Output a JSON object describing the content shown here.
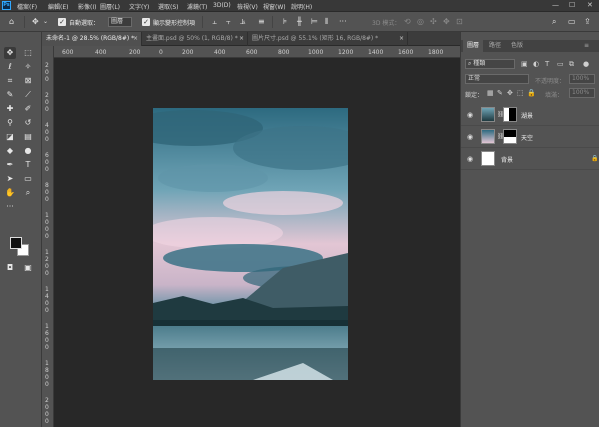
{
  "app": {
    "logo_text": "Ps"
  },
  "menu": [
    "檔案(F)",
    "編輯(E)",
    "影像(I)",
    "圖層(L)",
    "文字(Y)",
    "選取(S)",
    "濾鏡(T)",
    "3D(D)",
    "檢視(V)",
    "視窗(W)",
    "說明(H)"
  ],
  "window_controls": {
    "minimize": "—",
    "maximize": "☐",
    "close": "✕"
  },
  "options_bar": {
    "auto_select_label": "自動選取：",
    "auto_select_value": "圖層",
    "show_transform_label": "顯示變形控制項",
    "mode_3d_label": "3D 模式："
  },
  "tabs": [
    {
      "label": "未命名-1 @ 28.5% (RGB/8#) *",
      "active": true
    },
    {
      "label": "主畫面.psd @ 50% (1, RGB/8) *",
      "active": false
    },
    {
      "label": "圖片尺寸.psd @ 55.1% (矩形 16, RGB/8#) *",
      "active": false
    }
  ],
  "ruler_h": [
    "600",
    "400",
    "200",
    "0",
    "200",
    "400",
    "600",
    "800",
    "1000",
    "1200",
    "1400",
    "1600",
    "1800"
  ],
  "ruler_v": [
    "2",
    "0",
    "0",
    "2",
    "0",
    "0",
    "4",
    "0",
    "0",
    "6",
    "0",
    "0",
    "8",
    "0",
    "0",
    "1",
    "0",
    "0",
    "0",
    "1",
    "2",
    "0",
    "0",
    "1",
    "4",
    "0",
    "0",
    "1",
    "6",
    "0",
    "0",
    "1",
    "8",
    "0",
    "0",
    "2",
    "0",
    "0",
    "0"
  ],
  "panel": {
    "tabs": [
      "圖層",
      "路徑",
      "色版"
    ],
    "kind_filter": "種類",
    "blend_mode": "正常",
    "opacity_label": "不透明度：",
    "opacity_value": "100%",
    "lock_label": "鎖定：",
    "fill_label": "填滿：",
    "fill_value": "100%",
    "layers": [
      {
        "name": "湖景",
        "visible": true,
        "has_mask": true
      },
      {
        "name": "天空",
        "visible": true,
        "has_mask": true
      },
      {
        "name": "背景",
        "visible": true,
        "locked": true
      }
    ]
  },
  "colors": {
    "foreground": "#111111",
    "background": "#ffffff",
    "accent": "#31a8ff"
  }
}
